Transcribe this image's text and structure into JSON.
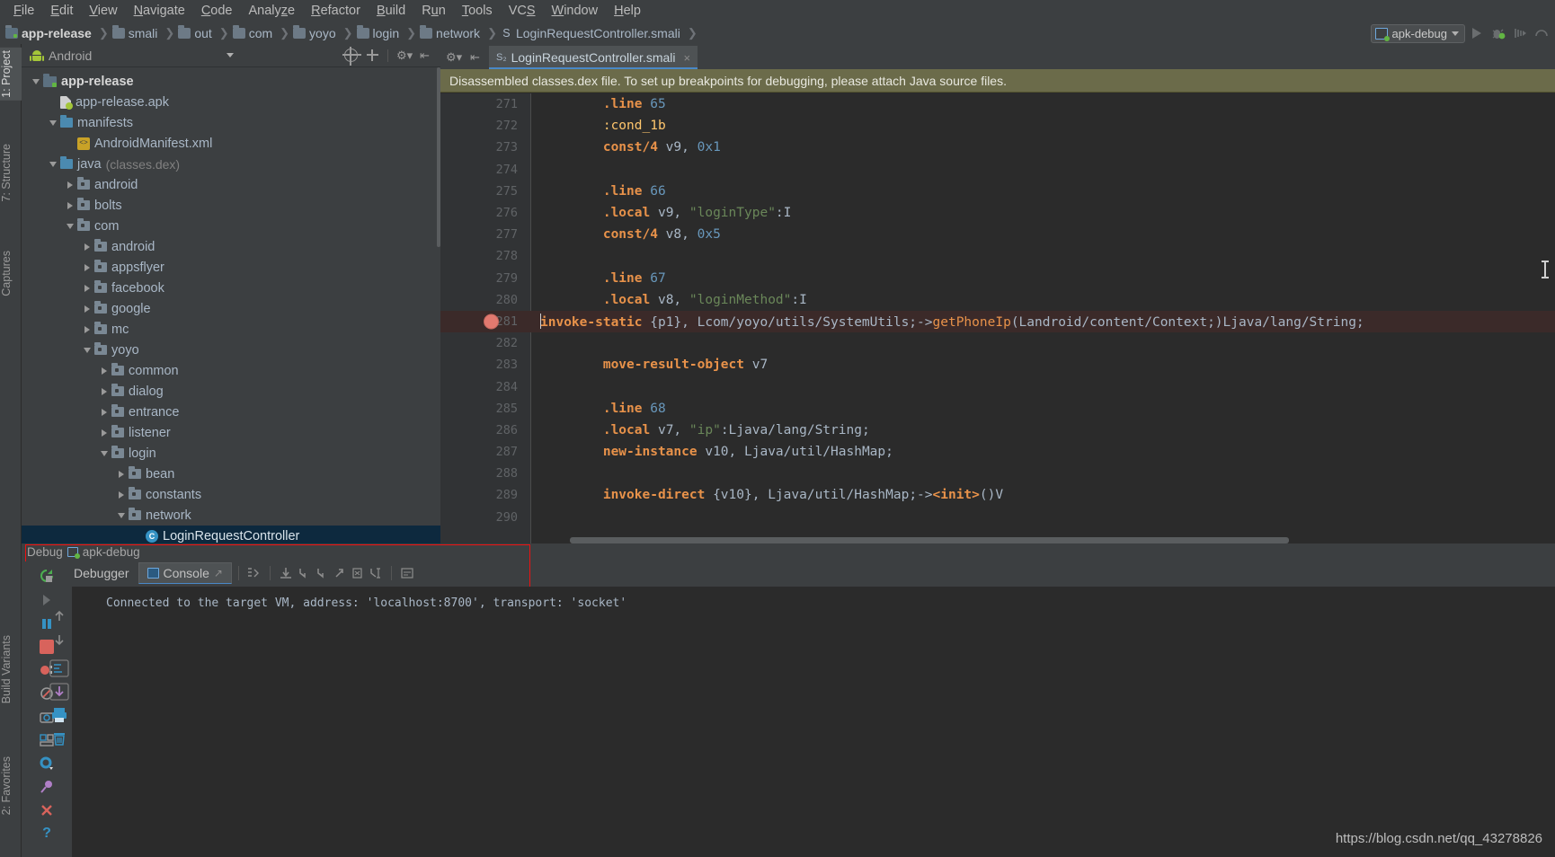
{
  "menu": {
    "items": [
      {
        "label": "File",
        "accel": "F"
      },
      {
        "label": "Edit",
        "accel": "E"
      },
      {
        "label": "View",
        "accel": "V"
      },
      {
        "label": "Navigate",
        "accel": "N"
      },
      {
        "label": "Code",
        "accel": "C"
      },
      {
        "label": "Analyze",
        "accel": "z"
      },
      {
        "label": "Refactor",
        "accel": "R"
      },
      {
        "label": "Build",
        "accel": "B"
      },
      {
        "label": "Run",
        "accel": "u"
      },
      {
        "label": "Tools",
        "accel": "T"
      },
      {
        "label": "VCS",
        "accel": "S"
      },
      {
        "label": "Window",
        "accel": "W"
      },
      {
        "label": "Help",
        "accel": "H"
      }
    ]
  },
  "breadcrumb": {
    "items": [
      {
        "label": "app-release",
        "icon": "module-folder-icon",
        "bold": true
      },
      {
        "label": "smali",
        "icon": "folder-icon",
        "bold": false
      },
      {
        "label": "out",
        "icon": "folder-icon",
        "bold": false
      },
      {
        "label": "com",
        "icon": "folder-icon",
        "bold": false
      },
      {
        "label": "yoyo",
        "icon": "folder-icon",
        "bold": false
      },
      {
        "label": "login",
        "icon": "folder-icon",
        "bold": false
      },
      {
        "label": "network",
        "icon": "folder-icon",
        "bold": false
      },
      {
        "label": "LoginRequestController.smali",
        "icon": "smali-file-icon",
        "bold": false
      }
    ]
  },
  "runbar": {
    "config_name": "apk-debug",
    "buttons": [
      "run-button",
      "debug-button",
      "attach-profiler-button",
      "profiler-button"
    ]
  },
  "left_strip": {
    "top": [
      {
        "label": "1: Project",
        "accel": "1",
        "selected": true
      },
      {
        "label": "7: Structure",
        "accel": "7",
        "selected": false
      },
      {
        "label": "Captures",
        "accel": "",
        "selected": false
      }
    ],
    "bottom": [
      {
        "label": "Build Variants",
        "accel": "",
        "selected": false
      },
      {
        "label": "2: Favorites",
        "accel": "2",
        "selected": false
      }
    ]
  },
  "project_panel": {
    "view_title": "Android",
    "toolbar_icons": [
      "locate-icon",
      "collapse-all-icon",
      "settings-icon",
      "hide-icon"
    ],
    "tree": [
      {
        "depth": 0,
        "label": "app-release",
        "icon": "module-icon",
        "twisty": "down",
        "bold": true,
        "selected": false,
        "suffix": ""
      },
      {
        "depth": 1,
        "label": "app-release.apk",
        "icon": "apk-icon",
        "twisty": "none",
        "bold": false,
        "selected": false,
        "suffix": ""
      },
      {
        "depth": 1,
        "label": "manifests",
        "icon": "blue-folder-icon",
        "twisty": "down",
        "bold": false,
        "selected": false,
        "suffix": ""
      },
      {
        "depth": 2,
        "label": "AndroidManifest.xml",
        "icon": "xml-file-icon",
        "twisty": "none",
        "bold": false,
        "selected": false,
        "suffix": ""
      },
      {
        "depth": 1,
        "label": "java",
        "icon": "blue-folder-icon",
        "twisty": "down",
        "bold": false,
        "selected": false,
        "suffix": "(classes.dex)"
      },
      {
        "depth": 2,
        "label": "android",
        "icon": "package-icon",
        "twisty": "right",
        "bold": false,
        "selected": false,
        "suffix": ""
      },
      {
        "depth": 2,
        "label": "bolts",
        "icon": "package-icon",
        "twisty": "right",
        "bold": false,
        "selected": false,
        "suffix": ""
      },
      {
        "depth": 2,
        "label": "com",
        "icon": "package-icon",
        "twisty": "down",
        "bold": false,
        "selected": false,
        "suffix": ""
      },
      {
        "depth": 3,
        "label": "android",
        "icon": "package-icon",
        "twisty": "right",
        "bold": false,
        "selected": false,
        "suffix": ""
      },
      {
        "depth": 3,
        "label": "appsflyer",
        "icon": "package-icon",
        "twisty": "right",
        "bold": false,
        "selected": false,
        "suffix": ""
      },
      {
        "depth": 3,
        "label": "facebook",
        "icon": "package-icon",
        "twisty": "right",
        "bold": false,
        "selected": false,
        "suffix": ""
      },
      {
        "depth": 3,
        "label": "google",
        "icon": "package-icon",
        "twisty": "right",
        "bold": false,
        "selected": false,
        "suffix": ""
      },
      {
        "depth": 3,
        "label": "mc",
        "icon": "package-icon",
        "twisty": "right",
        "bold": false,
        "selected": false,
        "suffix": ""
      },
      {
        "depth": 3,
        "label": "yoyo",
        "icon": "package-icon",
        "twisty": "down",
        "bold": false,
        "selected": false,
        "suffix": ""
      },
      {
        "depth": 4,
        "label": "common",
        "icon": "package-icon",
        "twisty": "right",
        "bold": false,
        "selected": false,
        "suffix": ""
      },
      {
        "depth": 4,
        "label": "dialog",
        "icon": "package-icon",
        "twisty": "right",
        "bold": false,
        "selected": false,
        "suffix": ""
      },
      {
        "depth": 4,
        "label": "entrance",
        "icon": "package-icon",
        "twisty": "right",
        "bold": false,
        "selected": false,
        "suffix": ""
      },
      {
        "depth": 4,
        "label": "listener",
        "icon": "package-icon",
        "twisty": "right",
        "bold": false,
        "selected": false,
        "suffix": ""
      },
      {
        "depth": 4,
        "label": "login",
        "icon": "package-icon",
        "twisty": "down",
        "bold": false,
        "selected": false,
        "suffix": ""
      },
      {
        "depth": 5,
        "label": "bean",
        "icon": "package-icon",
        "twisty": "right",
        "bold": false,
        "selected": false,
        "suffix": ""
      },
      {
        "depth": 5,
        "label": "constants",
        "icon": "package-icon",
        "twisty": "right",
        "bold": false,
        "selected": false,
        "suffix": ""
      },
      {
        "depth": 5,
        "label": "network",
        "icon": "package-icon",
        "twisty": "down",
        "bold": false,
        "selected": false,
        "suffix": ""
      },
      {
        "depth": 6,
        "label": "LoginRequestController",
        "icon": "class-icon",
        "twisty": "none",
        "bold": false,
        "selected": true,
        "suffix": ""
      }
    ]
  },
  "editor": {
    "tab_label": "LoginRequestController.smali",
    "tab_icon": "smali-file-icon",
    "tab_close": "×",
    "notice": "Disassembled classes.dex file. To set up breakpoints for debugging, please attach Java source files.",
    "lines": [
      {
        "num": "271",
        "bp": false,
        "caret": false,
        "tokens": [
          {
            "t": "        ",
            "c": "k-plain"
          },
          {
            "t": ".line",
            "c": "k-dir"
          },
          {
            "t": " ",
            "c": "k-plain"
          },
          {
            "t": "65",
            "c": "k-num"
          }
        ]
      },
      {
        "num": "272",
        "bp": false,
        "caret": false,
        "tokens": [
          {
            "t": "        ",
            "c": "k-plain"
          },
          {
            "t": ":cond_1b",
            "c": "k-label"
          }
        ]
      },
      {
        "num": "273",
        "bp": false,
        "caret": false,
        "tokens": [
          {
            "t": "        ",
            "c": "k-plain"
          },
          {
            "t": "const/4",
            "c": "k-dir"
          },
          {
            "t": " v9, ",
            "c": "k-reg"
          },
          {
            "t": "0x1",
            "c": "k-num"
          }
        ]
      },
      {
        "num": "274",
        "bp": false,
        "caret": false,
        "tokens": []
      },
      {
        "num": "275",
        "bp": false,
        "caret": false,
        "tokens": [
          {
            "t": "        ",
            "c": "k-plain"
          },
          {
            "t": ".line",
            "c": "k-dir"
          },
          {
            "t": " ",
            "c": "k-plain"
          },
          {
            "t": "66",
            "c": "k-num"
          }
        ]
      },
      {
        "num": "276",
        "bp": false,
        "caret": false,
        "tokens": [
          {
            "t": "        ",
            "c": "k-plain"
          },
          {
            "t": ".local",
            "c": "k-dir"
          },
          {
            "t": " v9, ",
            "c": "k-reg"
          },
          {
            "t": "\"loginType\"",
            "c": "k-str"
          },
          {
            "t": ":I",
            "c": "k-reg"
          }
        ]
      },
      {
        "num": "277",
        "bp": false,
        "caret": false,
        "tokens": [
          {
            "t": "        ",
            "c": "k-plain"
          },
          {
            "t": "const/4",
            "c": "k-dir"
          },
          {
            "t": " v8, ",
            "c": "k-reg"
          },
          {
            "t": "0x5",
            "c": "k-num"
          }
        ]
      },
      {
        "num": "278",
        "bp": false,
        "caret": false,
        "tokens": []
      },
      {
        "num": "279",
        "bp": false,
        "caret": false,
        "tokens": [
          {
            "t": "        ",
            "c": "k-plain"
          },
          {
            "t": ".line",
            "c": "k-dir"
          },
          {
            "t": " ",
            "c": "k-plain"
          },
          {
            "t": "67",
            "c": "k-num"
          }
        ]
      },
      {
        "num": "280",
        "bp": false,
        "caret": false,
        "tokens": [
          {
            "t": "        ",
            "c": "k-plain"
          },
          {
            "t": ".local",
            "c": "k-dir"
          },
          {
            "t": " v8, ",
            "c": "k-reg"
          },
          {
            "t": "\"loginMethod\"",
            "c": "k-str"
          },
          {
            "t": ":I",
            "c": "k-reg"
          }
        ]
      },
      {
        "num": "281",
        "bp": true,
        "caret": true,
        "tokens": [
          {
            "t": "invoke-static",
            "c": "k-dir"
          },
          {
            "t": " {p1}, ",
            "c": "k-reg"
          },
          {
            "t": "Lcom/yoyo/utils/SystemUtils;->",
            "c": "k-cls"
          },
          {
            "t": "getPhoneIp",
            "c": "k-meth"
          },
          {
            "t": "(Landroid/content/Context;)Ljava/lang/String;",
            "c": "k-cls"
          }
        ]
      },
      {
        "num": "282",
        "bp": false,
        "caret": false,
        "tokens": []
      },
      {
        "num": "283",
        "bp": false,
        "caret": false,
        "tokens": [
          {
            "t": "        ",
            "c": "k-plain"
          },
          {
            "t": "move-result-object",
            "c": "k-dir"
          },
          {
            "t": " v7",
            "c": "k-reg"
          }
        ]
      },
      {
        "num": "284",
        "bp": false,
        "caret": false,
        "tokens": []
      },
      {
        "num": "285",
        "bp": false,
        "caret": false,
        "tokens": [
          {
            "t": "        ",
            "c": "k-plain"
          },
          {
            "t": ".line",
            "c": "k-dir"
          },
          {
            "t": " ",
            "c": "k-plain"
          },
          {
            "t": "68",
            "c": "k-num"
          }
        ]
      },
      {
        "num": "286",
        "bp": false,
        "caret": false,
        "tokens": [
          {
            "t": "        ",
            "c": "k-plain"
          },
          {
            "t": ".local",
            "c": "k-dir"
          },
          {
            "t": " v7, ",
            "c": "k-reg"
          },
          {
            "t": "\"ip\"",
            "c": "k-str"
          },
          {
            "t": ":Ljava/lang/String;",
            "c": "k-cls"
          }
        ]
      },
      {
        "num": "287",
        "bp": false,
        "caret": false,
        "tokens": [
          {
            "t": "        ",
            "c": "k-plain"
          },
          {
            "t": "new-instance",
            "c": "k-dir"
          },
          {
            "t": " v10, ",
            "c": "k-reg"
          },
          {
            "t": "Ljava/util/HashMap;",
            "c": "k-cls"
          }
        ]
      },
      {
        "num": "288",
        "bp": false,
        "caret": false,
        "tokens": []
      },
      {
        "num": "289",
        "bp": false,
        "caret": false,
        "tokens": [
          {
            "t": "        ",
            "c": "k-plain"
          },
          {
            "t": "invoke-direct",
            "c": "k-dir"
          },
          {
            "t": " {v10}, ",
            "c": "k-reg"
          },
          {
            "t": "Ljava/util/HashMap;->",
            "c": "k-cls"
          },
          {
            "t": "<init>",
            "c": "k-init"
          },
          {
            "t": "()V",
            "c": "k-cls"
          }
        ]
      },
      {
        "num": "290",
        "bp": false,
        "caret": false,
        "tokens": []
      }
    ]
  },
  "debug": {
    "panel_title": "Debug",
    "config_name": "apk-debug",
    "tabs": [
      {
        "label": "Debugger",
        "icon": "debugger-icon",
        "active": false
      },
      {
        "label": "Console",
        "icon": "console-icon",
        "active": true
      }
    ],
    "toolbar_icons": [
      "show-execution-point-icon",
      "step-over-icon",
      "step-into-icon",
      "force-step-into-icon",
      "step-out-icon",
      "drop-frame-icon",
      "run-to-cursor-icon",
      "evaluate-expression-icon"
    ],
    "console_text": "Connected to the target VM, address: 'localhost:8700', transport: 'socket'",
    "side_icons": [
      "rerun-icon",
      "resume-icon",
      "pause-icon",
      "stop-icon",
      "view-breakpoints-icon",
      "mute-breakpoints-icon",
      "screenshot-icon",
      "layout-inspector-icon",
      "settings-icon",
      "pin-icon",
      "close-icon",
      "help-icon"
    ],
    "right_icons": [
      "soft-wrap-icon",
      "scroll-to-end-icon",
      "print-icon",
      "clear-all-icon"
    ]
  },
  "watermark": "https://blog.csdn.net/qq_43278826",
  "colors": {
    "accent_blue": "#4a88c7",
    "selection_blue": "#0d293e",
    "breakpoint_red": "#e2796f",
    "notice_olive": "#6b6b4a",
    "redbox": "#ee1111"
  }
}
